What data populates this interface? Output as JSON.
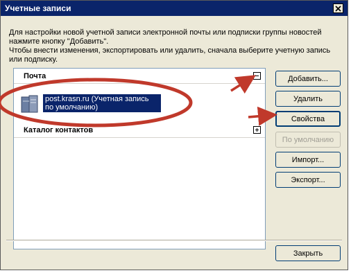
{
  "window": {
    "title": "Учетные записи"
  },
  "description": {
    "line1": "Для настройки новой учетной записи электронной почты или подписки группы новостей",
    "line2": "нажмите кнопку \"Добавить\".",
    "line3": "Чтобы внести изменения, экспортировать или удалить, сначала выберите учетную запись",
    "line4": "или подписку."
  },
  "list": {
    "mail_group": "Почта",
    "account": {
      "line1": "post.krasn.ru (Учетная запись",
      "line2": "по умолчанию)"
    },
    "contacts_group": "Каталог контактов"
  },
  "buttons": {
    "add": "Добавить...",
    "delete": "Удалить",
    "properties": "Свойства",
    "default": "По умолчанию",
    "import": "Импорт...",
    "export": "Экспорт...",
    "close": "Закрыть"
  },
  "colors": {
    "titlebar": "#0a246a",
    "annotation": "#c0392b",
    "selection": "#0a246a"
  }
}
